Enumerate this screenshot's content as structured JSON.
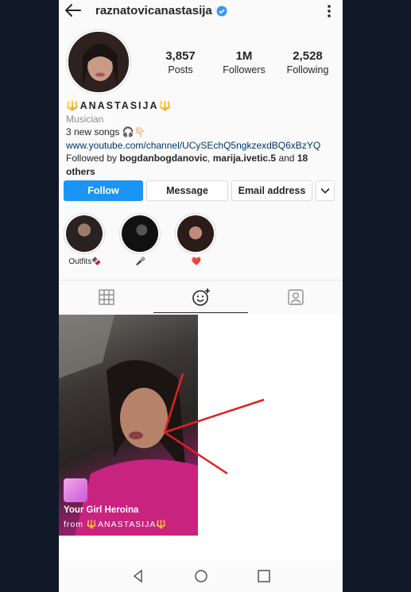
{
  "profile": {
    "username": "raznatovicanastasija",
    "verified": true,
    "posts": "3,857",
    "posts_label": "Posts",
    "followers": "1M",
    "followers_label": "Followers",
    "following": "2,528",
    "following_label": "Following"
  },
  "bio": {
    "name": "🔱ANASTASIJA🔱",
    "category": "Musician",
    "line1": "3 new songs 🎧👇🏻",
    "link": "www.youtube.com/channel/UCySEchQ5ngkzexdBQ6xBzYQ",
    "followed_prefix": "Followed by ",
    "followed_user1": "bogdanbogdanovic",
    "followed_sep": ", ",
    "followed_user2": "marija.ivetic.5",
    "followed_and": " and ",
    "followed_others": "18 others"
  },
  "buttons": {
    "follow": "Follow",
    "message": "Message",
    "email": "Email address"
  },
  "highlights": [
    {
      "label": "Outfits🍫"
    },
    {
      "label": "🎤"
    },
    {
      "label": "❤️"
    }
  ],
  "tabs": [
    "grid-icon",
    "reels-icon",
    "tagged-icon"
  ],
  "reel": {
    "title": "Your Girl Heroina",
    "from": "from 🔱ANASTASIJA🔱"
  },
  "colors": {
    "follow_button": "#1b95f5",
    "link": "#00376b",
    "verified": "#3897f0",
    "annotation_arrow": "#e02020"
  }
}
